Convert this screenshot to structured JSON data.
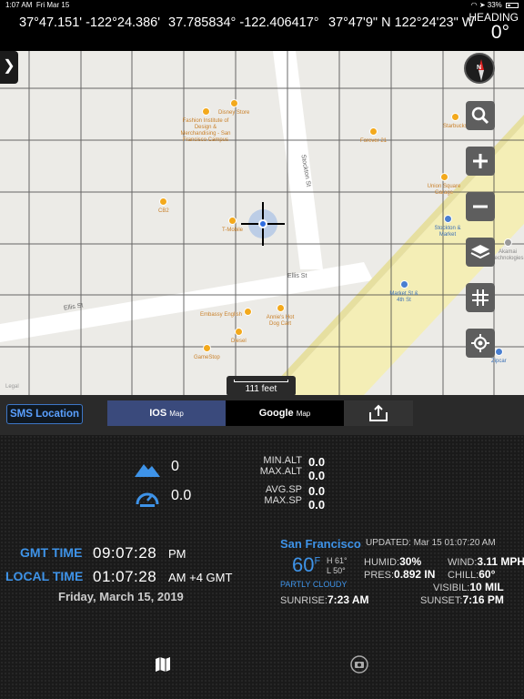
{
  "status": {
    "time": "1:07 AM",
    "date": "Fri Mar 15",
    "battery": "33%"
  },
  "header": {
    "coord_dm": "37°47.151' -122°24.386'",
    "coord_decimal": "37.785834° -122.406417°",
    "coord_dms": "37°47'9\" N 122°24'23\" W",
    "heading_label": "HEADING",
    "heading_value": "0°"
  },
  "map": {
    "pois": [
      {
        "label": "Disney Store",
        "tone": "orange"
      },
      {
        "label": "Fashion Institute of Design & Merchandising - San Francisco Campus",
        "tone": "orange"
      },
      {
        "label": "Forever 21",
        "tone": "orange"
      },
      {
        "label": "Starbucks",
        "tone": "orange"
      },
      {
        "label": "Union Square Garage",
        "tone": "orange"
      },
      {
        "label": "CB2",
        "tone": "orange"
      },
      {
        "label": "T-Mobile",
        "tone": "orange"
      },
      {
        "label": "Stockton & Market",
        "tone": "blue"
      },
      {
        "label": "Akamai Technologies",
        "tone": "gray"
      },
      {
        "label": "Market St & 4th St",
        "tone": "blue"
      },
      {
        "label": "Embassy English",
        "tone": "orange"
      },
      {
        "label": "Annie's Hot Dog Cart",
        "tone": "orange"
      },
      {
        "label": "Diesel",
        "tone": "orange"
      },
      {
        "label": "GameStop",
        "tone": "orange"
      },
      {
        "label": "Zipcar",
        "tone": "blue"
      }
    ],
    "streets": {
      "stockton": "Stockton St",
      "ellis_right": "Ellis St",
      "ellis_left": "Ellis St"
    },
    "scale_label": "111 feet",
    "legal": "Legal",
    "side_handle": "❯",
    "compass_letter": "N"
  },
  "controls": {
    "sms_label": "SMS  Location",
    "ios_label": "IOS",
    "ios_suffix": "Map",
    "google_label": "Google",
    "google_suffix": "Map"
  },
  "stats": {
    "altitude": "0",
    "speed": "0.0",
    "min_alt_label": "MIN.ALT",
    "min_alt": "0.0",
    "max_alt_label": "MAX.ALT",
    "max_alt": "0.0",
    "avg_sp_label": "AVG.SP",
    "avg_sp": "0.0",
    "max_sp_label": "MAX.SP",
    "max_sp": "0.0"
  },
  "time": {
    "gmt_label": "GMT TIME",
    "gmt_value": "09:07:28",
    "gmt_suffix": "PM",
    "local_label": "LOCAL TIME",
    "local_value": "01:07:28",
    "local_suffix": "AM +4 GMT",
    "date": "Friday, March 15, 2019"
  },
  "weather": {
    "city": "San Francisco",
    "updated": "UPDATED: Mar 15 01:07:20 AM",
    "temp": "60",
    "unit": "F",
    "high": "H 61°",
    "low": "L 50°",
    "condition": "PARTLY CLOUDY",
    "humid_label": "HUMID:",
    "humid": "30%",
    "pres_label": "PRES:",
    "pres": "0.892 IN",
    "wind_label": "WIND:",
    "wind": "3.11 MPH",
    "chill_label": "CHILL:",
    "chill": "60°",
    "visib_label": "VISIBIL:",
    "visib": "10 MIL",
    "sunrise_label": "SUNRISE:",
    "sunrise": "7:23 AM",
    "sunset_label": "SUNSET:",
    "sunset": "7:16 PM"
  },
  "icons": {
    "map_tab": "map-icon",
    "camera_tab": "camera-icon"
  }
}
